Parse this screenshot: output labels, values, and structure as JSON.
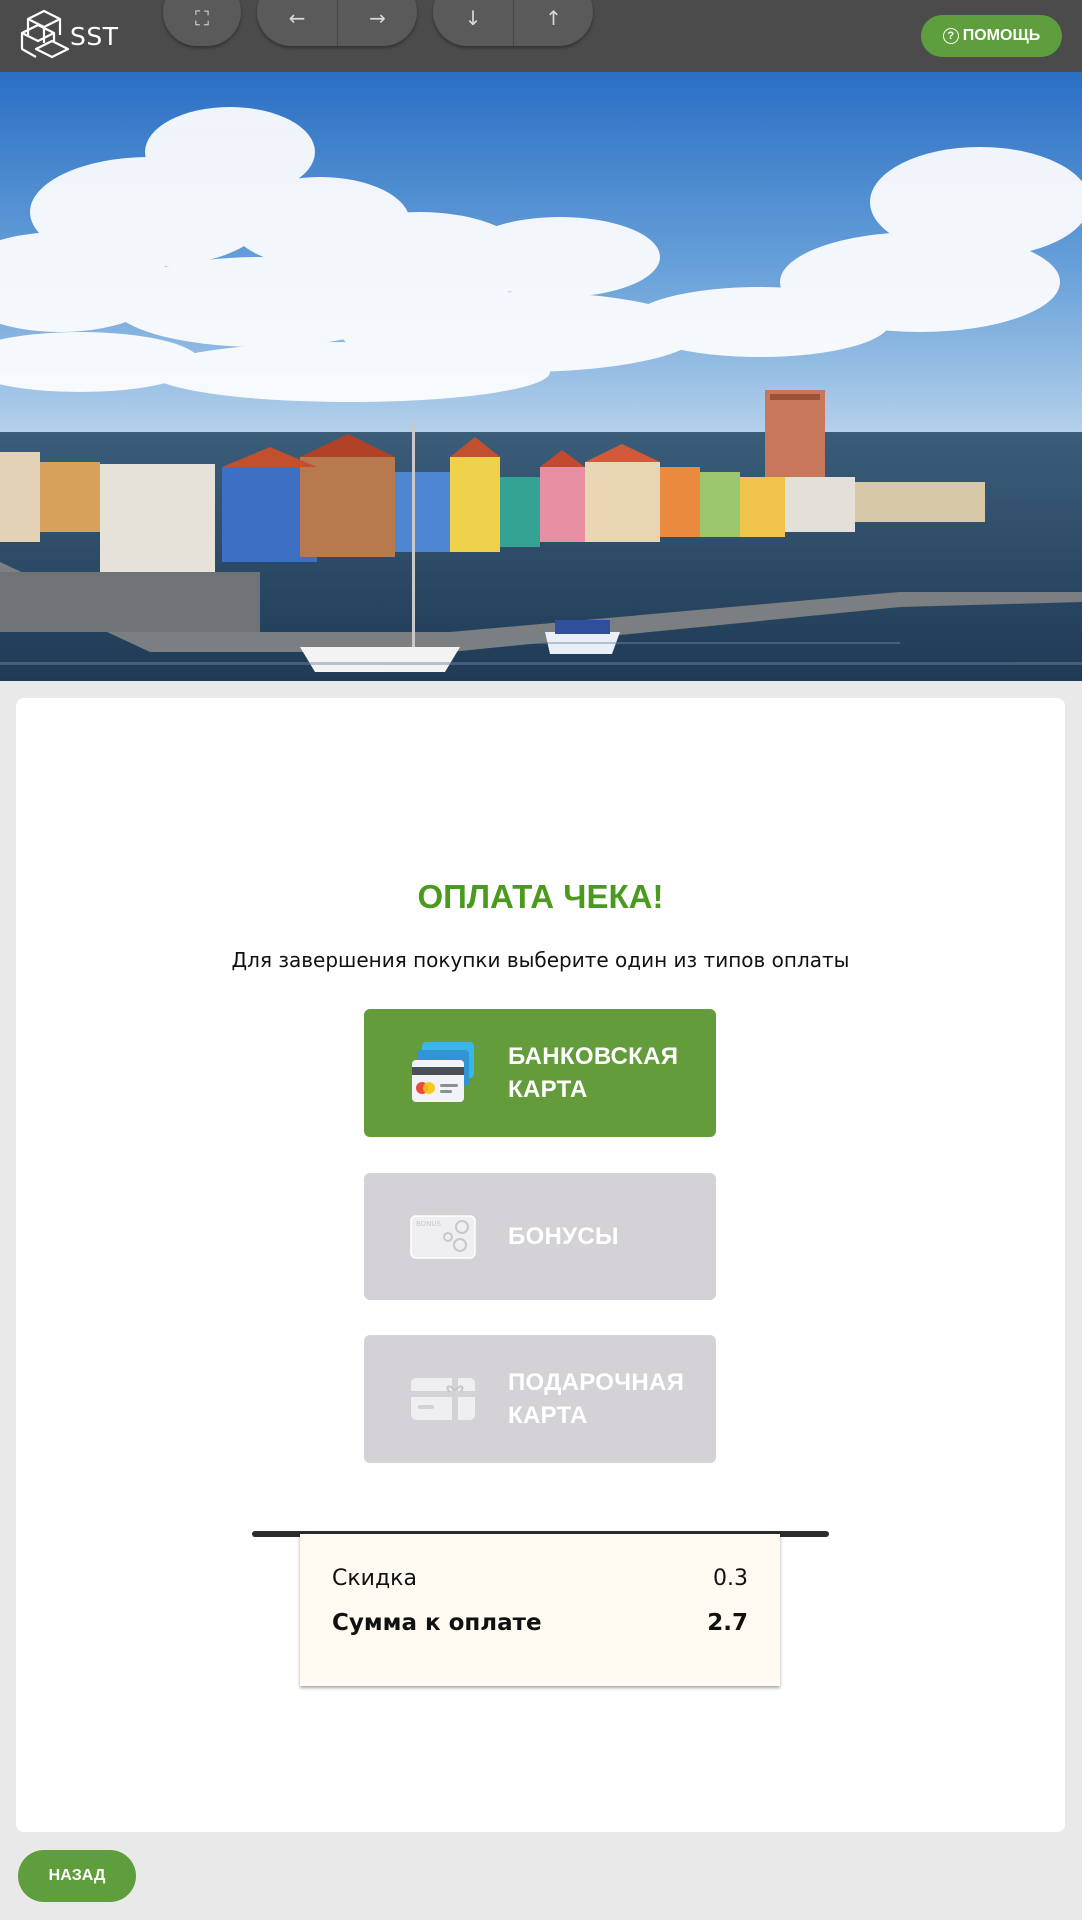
{
  "header": {
    "logo_text": "SST",
    "controls": {
      "fullscreen_icon": "⛶",
      "back_arrow": "←",
      "forward_arrow": "→",
      "down_arrow": "↓",
      "up_arrow": "↑"
    },
    "help_label": "ПОМОЩЬ",
    "help_icon": "?"
  },
  "main": {
    "title": "ОПЛАТА ЧЕКА!",
    "subtitle": "Для завершения покупки выберите один из типов оплаты",
    "payment_options": [
      {
        "label": "БАНКОВСКАЯ\nКАРТА",
        "icon": "bank-card-icon",
        "enabled": true
      },
      {
        "label": "БОНУСЫ",
        "icon": "bonus-card-icon",
        "enabled": false
      },
      {
        "label": "ПОДАРОЧНАЯ\nКАРТА",
        "icon": "gift-card-icon",
        "enabled": false
      }
    ],
    "receipt": {
      "discount_label": "Скидка",
      "discount_value": "0.3",
      "total_label": "Сумма к оплате",
      "total_value": "2.7"
    }
  },
  "footer": {
    "back_label": "НАЗАД"
  },
  "colors": {
    "accent": "#649c3b",
    "title": "#4a9a1e",
    "disabled": "#d4d2d6",
    "topbar": "#4b4b4b"
  }
}
